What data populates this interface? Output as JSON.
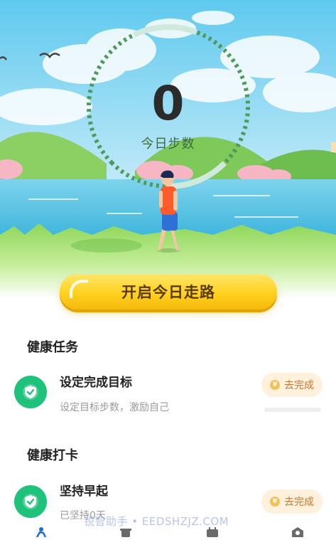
{
  "steps": {
    "count": "0",
    "label": "今日步数"
  },
  "start_button": {
    "label": "开启今日走路"
  },
  "health_tasks": {
    "title": "健康任务",
    "items": [
      {
        "title": "设定完成目标",
        "subtitle": "设定目标步数，激励自己",
        "action": "去完成",
        "coin_symbol": "¥"
      }
    ]
  },
  "health_checkin": {
    "title": "健康打卡",
    "items": [
      {
        "title": "坚持早起",
        "subtitle": "已坚持0天",
        "action": "去完成",
        "coin_symbol": "¥"
      }
    ]
  },
  "watermark": "锐智助手 • EEDSHZJZ.COM",
  "tabbar": {
    "icons": [
      "walk-icon",
      "cup-icon",
      "calendar-icon",
      "profile-icon"
    ]
  },
  "colors": {
    "accent_green": "#1ec27a",
    "button_yellow": "#ffd21f",
    "coin_orange": "#c8773a"
  }
}
